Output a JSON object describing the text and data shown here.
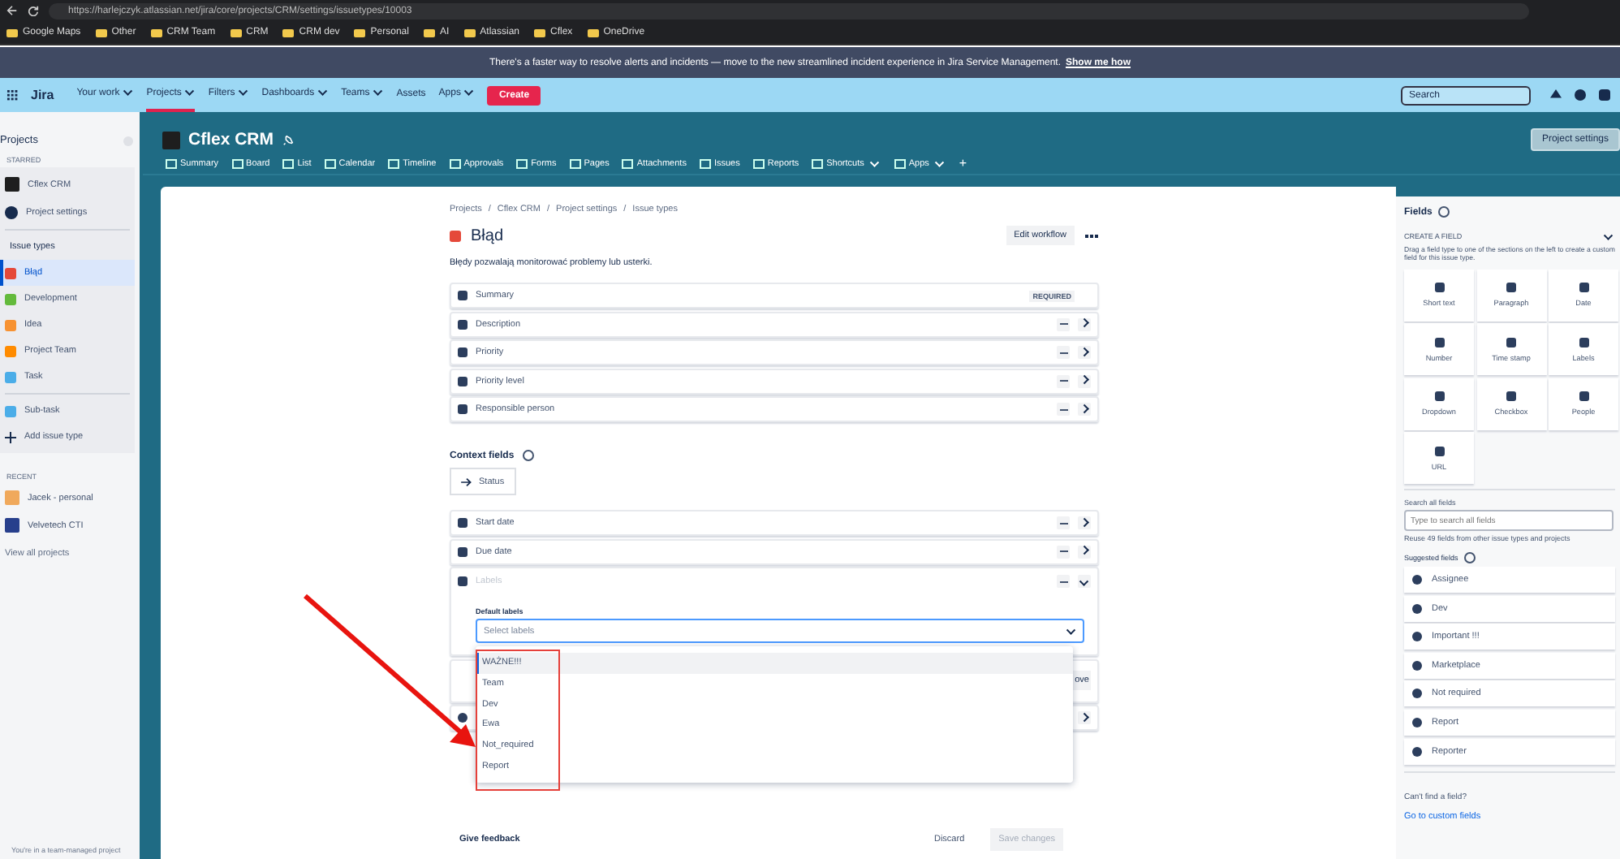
{
  "browser": {
    "url": "https://harlejczyk.atlassian.net/jira/core/projects/CRM/settings/issuetypes/10003",
    "bookmarks": [
      "Google Maps",
      "Other",
      "CRM Team",
      "CRM",
      "CRM dev",
      "Personal",
      "AI",
      "Atlassian",
      "Cflex",
      "OneDrive"
    ]
  },
  "banner": {
    "text": "There's a faster way to resolve alerts and incidents — move to the new streamlined incident experience in Jira Service Management.",
    "link": "Show me how"
  },
  "nav": {
    "product": "Jira",
    "items": [
      {
        "label": "Your work",
        "dropdown": true,
        "selected": false
      },
      {
        "label": "Projects",
        "dropdown": true,
        "selected": true
      },
      {
        "label": "Filters",
        "dropdown": true,
        "selected": false
      },
      {
        "label": "Dashboards",
        "dropdown": true,
        "selected": false
      },
      {
        "label": "Teams",
        "dropdown": true,
        "selected": false
      },
      {
        "label": "Assets",
        "dropdown": false,
        "selected": false
      },
      {
        "label": "Apps",
        "dropdown": true,
        "selected": false
      }
    ],
    "create": "Create",
    "search_placeholder": "Search"
  },
  "sidebar": {
    "title": "Projects",
    "starred_label": "STARRED",
    "project": "Cflex CRM",
    "settings": "Project settings",
    "issue_types_label": "Issue types",
    "issue_types": [
      {
        "label": "Błąd",
        "color": "#e5493a",
        "selected": true
      },
      {
        "label": "Development",
        "color": "#63ba3c",
        "selected": false
      },
      {
        "label": "Idea",
        "color": "#f79232",
        "selected": false
      },
      {
        "label": "Project Team",
        "color": "#ff8b00",
        "selected": false
      },
      {
        "label": "Task",
        "color": "#4bade8",
        "selected": false
      }
    ],
    "subtask": {
      "label": "Sub-task",
      "color": "#4bade8"
    },
    "add": "Add issue type",
    "recent_label": "RECENT",
    "recent": [
      "Jacek - personal",
      "Velvetech CTI"
    ],
    "view_all": "View all projects",
    "footer": "You're in a team-managed project"
  },
  "project": {
    "name": "Cflex CRM",
    "settings_button": "Project settings",
    "tabs": [
      {
        "label": "Summary",
        "dropdown": false
      },
      {
        "label": "Board",
        "dropdown": false
      },
      {
        "label": "List",
        "dropdown": false
      },
      {
        "label": "Calendar",
        "dropdown": false
      },
      {
        "label": "Timeline",
        "dropdown": false
      },
      {
        "label": "Approvals",
        "dropdown": false
      },
      {
        "label": "Forms",
        "dropdown": false
      },
      {
        "label": "Pages",
        "dropdown": false
      },
      {
        "label": "Attachments",
        "dropdown": false
      },
      {
        "label": "Issues",
        "dropdown": false
      },
      {
        "label": "Reports",
        "dropdown": false
      },
      {
        "label": "Shortcuts",
        "dropdown": true
      },
      {
        "label": "Apps",
        "dropdown": true
      }
    ],
    "add_tab": "+"
  },
  "page": {
    "breadcrumb_separator": "/",
    "breadcrumbs": [
      "Projects",
      "Cflex CRM",
      "Project settings",
      "Issue types"
    ],
    "title": "Błąd",
    "edit_workflow": "Edit workflow",
    "description": "Błędy pozwalają monitorować problemy lub usterki.",
    "fields": [
      {
        "label": "Summary",
        "required": "REQUIRED"
      },
      {
        "label": "Description"
      },
      {
        "label": "Priority"
      },
      {
        "label": "Priority level"
      },
      {
        "label": "Responsible person"
      }
    ],
    "context_title": "Context fields",
    "status": "Status",
    "context_fields": [
      {
        "label": "Start date"
      },
      {
        "label": "Due date"
      }
    ],
    "labels_field": {
      "label": "Labels",
      "default_label": "Default labels",
      "placeholder": "Select labels"
    },
    "options": [
      {
        "label": "WAŻNE!!!",
        "selected": true
      },
      {
        "label": "Team",
        "selected": false
      },
      {
        "label": "Dev",
        "selected": false
      },
      {
        "label": "Ewa",
        "selected": false
      },
      {
        "label": "Not_required",
        "selected": false
      },
      {
        "label": "Report",
        "selected": false
      }
    ],
    "hidden_button": "ove",
    "feedback": "Give feedback",
    "discard": "Discard",
    "save": {
      "label": "Save changes",
      "disabled": true
    }
  },
  "fields_panel": {
    "title": "Fields",
    "create_label": "CREATE A FIELD",
    "hint": "Drag a field type to one of the sections on the left to create a custom field for this issue type.",
    "types": [
      "Short text",
      "Paragraph",
      "Date",
      "Number",
      "Time stamp",
      "Labels",
      "Dropdown",
      "Checkbox",
      "People",
      "URL"
    ],
    "search_label": "Search all fields",
    "search_placeholder": "Type to search all fields",
    "reuse": "Reuse 49 fields from other issue types and projects",
    "suggested_label": "Suggested fields",
    "suggested": [
      "Assignee",
      "Dev",
      "Important !!!",
      "Marketplace",
      "Not required",
      "Report",
      "Reporter"
    ],
    "cant_find": "Can't find a field?",
    "custom_link": "Go to custom fields"
  }
}
